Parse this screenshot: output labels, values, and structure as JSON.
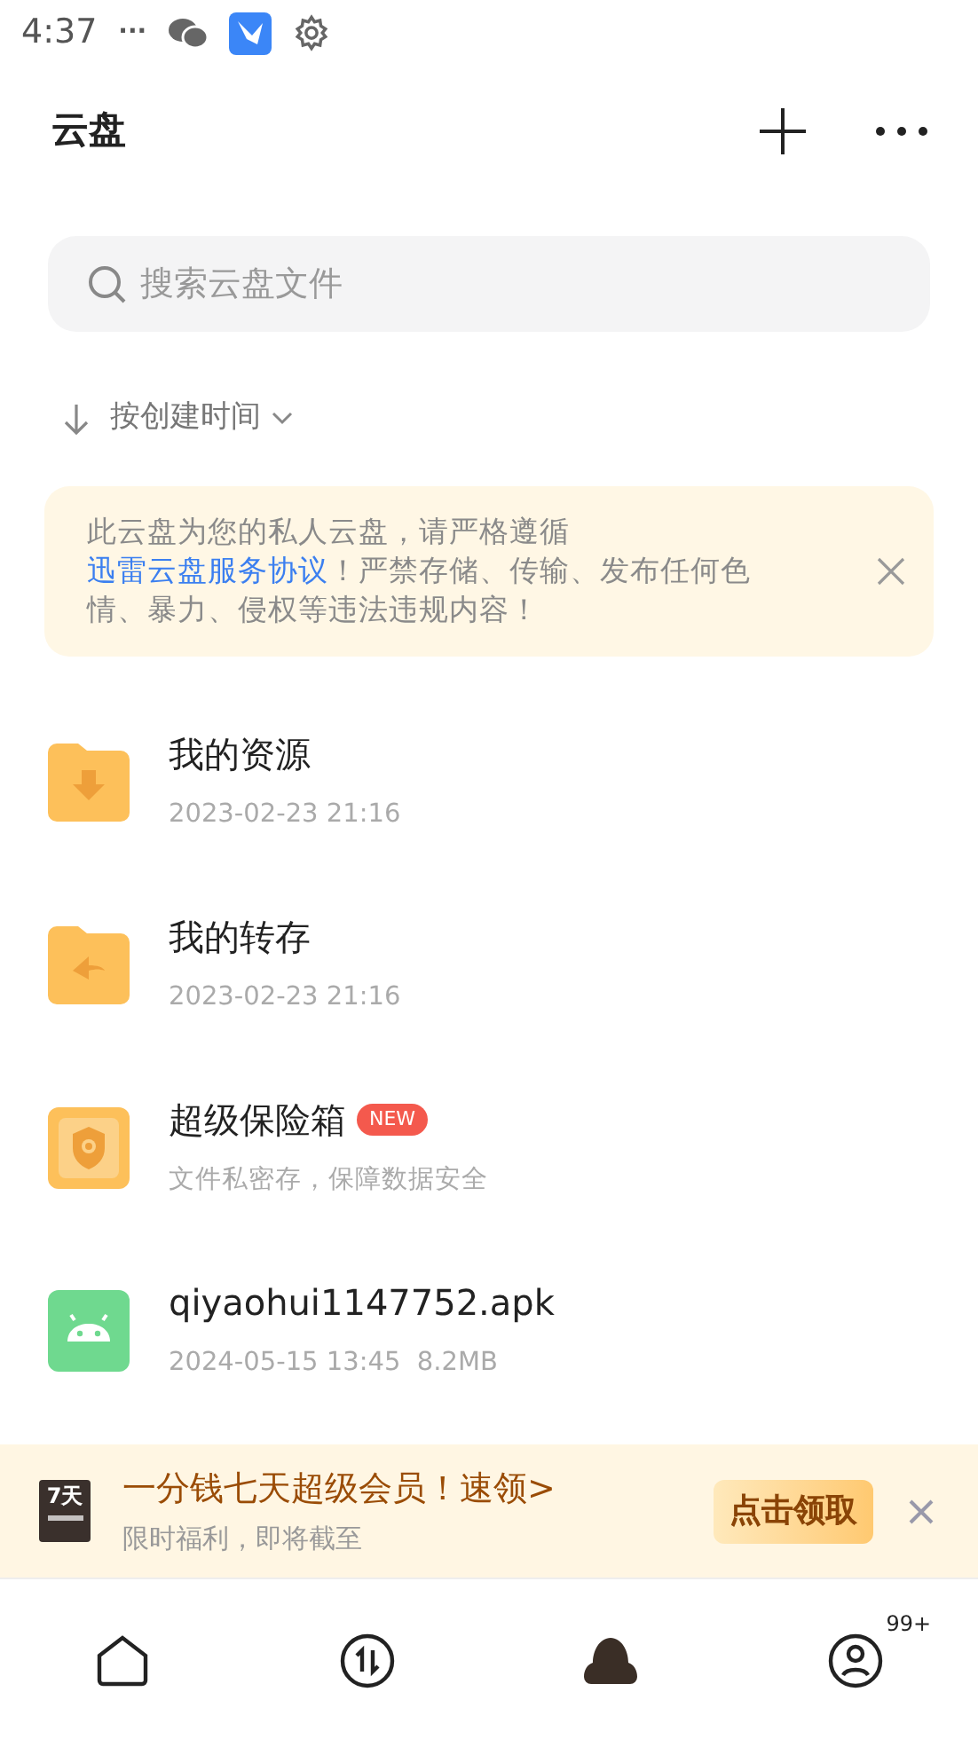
{
  "status_bar": {
    "time": "4:37",
    "dots": "···"
  },
  "header": {
    "title": "云盘"
  },
  "search": {
    "placeholder": "搜索云盘文件"
  },
  "sort": {
    "label": "按创建时间"
  },
  "notice": {
    "text": "此云盘为您的私人云盘，请严格遵循",
    "link": "迅雷云盘服务协议",
    "text_after": "！严禁存储、传输、发布任何色情、暴力、侵权等违法违规内容！"
  },
  "files": [
    {
      "kind": "download-folder",
      "name": "我的资源",
      "meta": "2023-02-23 21:16"
    },
    {
      "kind": "transfer-folder",
      "name": "我的转存",
      "meta": "2023-02-23 21:16"
    },
    {
      "kind": "safe",
      "name": "超级保险箱",
      "badge": "NEW",
      "meta": "文件私密存，保障数据安全"
    },
    {
      "kind": "apk",
      "name": "qiyaohui1147752.apk",
      "meta": "2024-05-15 13:45  8.2MB"
    }
  ],
  "promo": {
    "badge": "7天",
    "title": "一分钱七天超级会员！速领>",
    "subtitle": "限时福利，即将截至",
    "button": "点击领取"
  },
  "nav": [
    {
      "kind": "home",
      "selected": false
    },
    {
      "kind": "transfer",
      "selected": false
    },
    {
      "kind": "cloud",
      "selected": true
    },
    {
      "kind": "profile",
      "selected": false,
      "badge": "99+"
    }
  ]
}
